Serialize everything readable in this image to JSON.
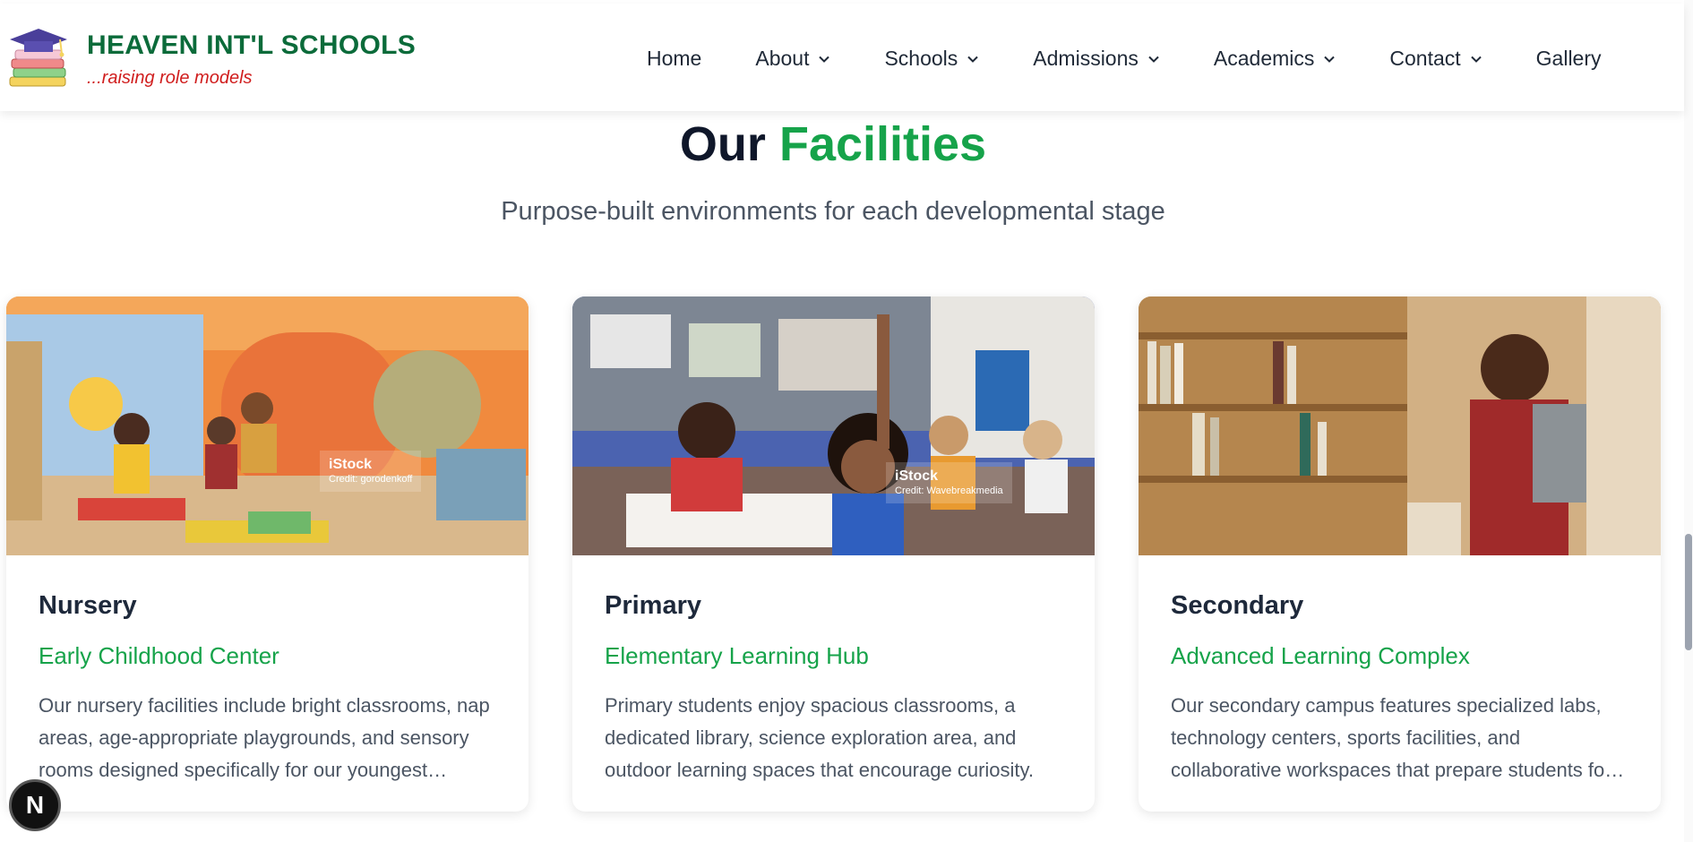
{
  "brand": {
    "name": "HEAVEN INT'L SCHOOLS",
    "tagline": "...raising role models"
  },
  "nav": {
    "items": [
      {
        "label": "Home",
        "has_dropdown": false
      },
      {
        "label": "About",
        "has_dropdown": true
      },
      {
        "label": "Schools",
        "has_dropdown": true
      },
      {
        "label": "Admissions",
        "has_dropdown": true
      },
      {
        "label": "Academics",
        "has_dropdown": true
      },
      {
        "label": "Contact",
        "has_dropdown": true
      },
      {
        "label": "Gallery",
        "has_dropdown": false
      }
    ]
  },
  "section": {
    "title_part1": "Our",
    "title_part2": "Facilities",
    "subtitle": "Purpose-built environments for each developmental stage"
  },
  "cards": [
    {
      "title": "Nursery",
      "subtitle": "Early Childhood Center",
      "text": "Our nursery facilities include bright classrooms, nap areas, age-appropriate playgrounds, and sensory rooms designed specifically for our youngest learners.",
      "watermark_brand": "iStock",
      "watermark_credit": "Credit: gorodenkoff"
    },
    {
      "title": "Primary",
      "subtitle": "Elementary Learning Hub",
      "text": "Primary students enjoy spacious classrooms, a dedicated library, science exploration area, and outdoor learning spaces that encourage curiosity.",
      "watermark_brand": "iStock",
      "watermark_credit": "Credit: Wavebreakmedia"
    },
    {
      "title": "Secondary",
      "subtitle": "Advanced Learning Complex",
      "text": "Our secondary campus features specialized labs, technology centers, sports facilities, and collaborative workspaces that prepare students for the future.",
      "watermark_brand": "",
      "watermark_credit": ""
    }
  ],
  "floating_button": {
    "label": "N"
  },
  "colors": {
    "brand_green": "#0b6b3a",
    "accent_green": "#16a34a",
    "tagline_red": "#d01d1d",
    "heading_dark": "#0f172a"
  },
  "icons": [
    "graduation-cap-books-logo",
    "chevron-down-icon"
  ]
}
